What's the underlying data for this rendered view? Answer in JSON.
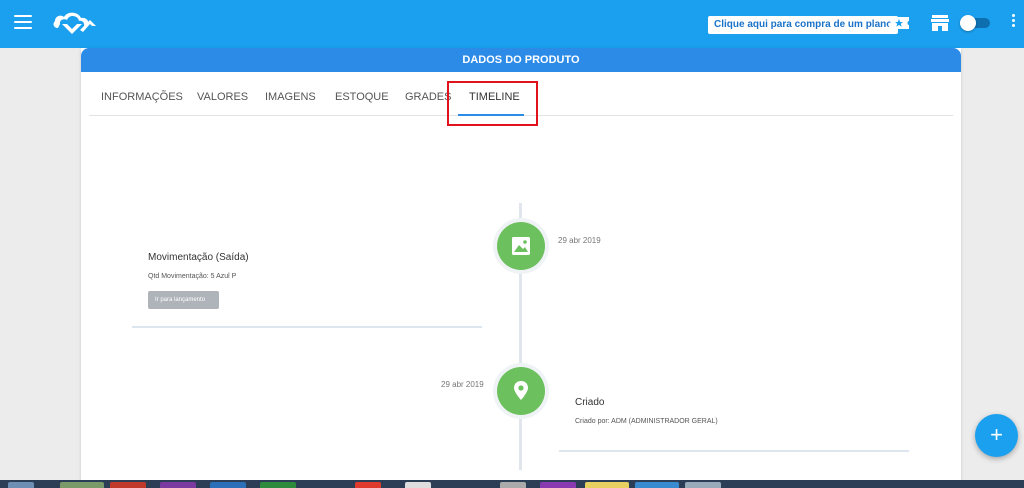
{
  "header": {
    "plan_button": "Clique aqui para compra de um plano",
    "icons": [
      "menu-icon",
      "logo",
      "ticket-icon",
      "store-icon",
      "toggle",
      "more-vert-icon"
    ],
    "accent": "#1aa0ee"
  },
  "card": {
    "title": "DADOS DO PRODUTO",
    "tabs": [
      {
        "label": "INFORMAÇÕES"
      },
      {
        "label": "VALORES"
      },
      {
        "label": "IMAGENS"
      },
      {
        "label": "ESTOQUE"
      },
      {
        "label": "GRADES"
      },
      {
        "label": "TIMELINE"
      }
    ],
    "active_tab": "TIMELINE"
  },
  "timeline": [
    {
      "date": "29 abr 2019",
      "title": "Movimentação (Saída)",
      "description": "Qtd Movimentação: 5 Azul P",
      "button": "Ir para lançamento",
      "icon": "image-icon",
      "color": "#6cc05d"
    },
    {
      "date": "29 abr 2019",
      "title": "Criado",
      "description": "Criado por: ADM (ADMINISTRADOR GERAL)",
      "icon": "location-pin-icon",
      "color": "#6cc05d"
    }
  ],
  "fab": {
    "label": "+"
  }
}
